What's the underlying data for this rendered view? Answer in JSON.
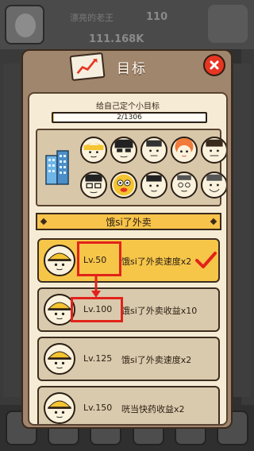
{
  "background": {
    "player_name": "漂亮的老王",
    "player_count": "110",
    "gold": "111.168K"
  },
  "modal": {
    "title": "目标",
    "goal_label": "给自己定个小目标",
    "progress_text": "2/1306",
    "progress": {
      "current": 2,
      "total": 1306
    },
    "section_title": "饿si了外卖"
  },
  "goals": [
    {
      "level": "Lv.50",
      "desc": "饿si了外卖速度x2",
      "completed": true
    },
    {
      "level": "Lv.100",
      "desc": "饿si了外卖收益x10",
      "completed": false
    },
    {
      "level": "Lv.125",
      "desc": "饿si了外卖速度x2",
      "completed": false
    },
    {
      "level": "Lv.150",
      "desc": "咣当快药收益x2",
      "completed": false
    }
  ],
  "colors": {
    "accent_yellow": "#f6c649",
    "close_red": "#e63622",
    "highlight_red": "#e2231a",
    "panel_cream": "#f6ecd5",
    "modal_brown": "#a1866e"
  },
  "icons": {
    "title": "chart-board-icon",
    "close": "close-icon",
    "check": "checkmark-icon",
    "building": "building-icon"
  }
}
